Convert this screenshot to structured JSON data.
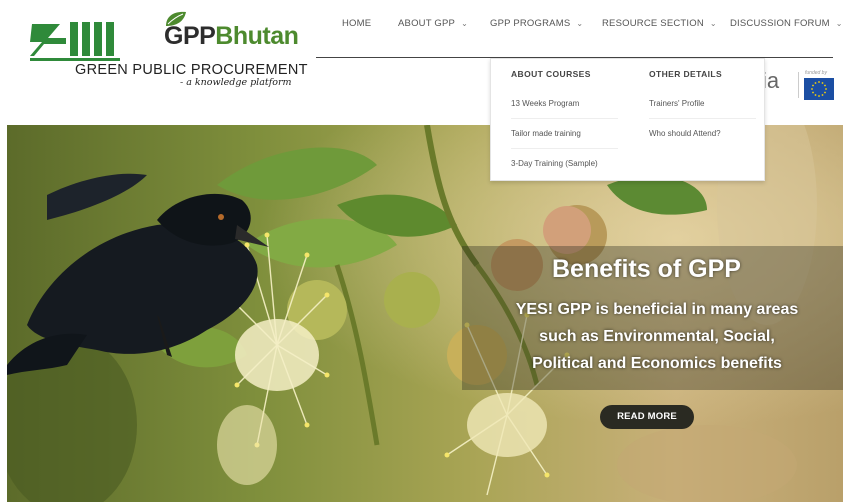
{
  "logo": {
    "bhutan_prefix": "GPP",
    "bhutan_suffix": "Bhutan",
    "name": "GREEN PUBLIC PROCUREMENT",
    "tagline": "- a knowledge platform"
  },
  "nav": {
    "items": [
      {
        "label": "HOME",
        "has_dropdown": false
      },
      {
        "label": "ABOUT GPP",
        "has_dropdown": true
      },
      {
        "label": "GPP PROGRAMS",
        "has_dropdown": true
      },
      {
        "label": "RESOURCE SECTION",
        "has_dropdown": true
      },
      {
        "label": "DISCUSSION FORUM",
        "has_dropdown": true
      }
    ]
  },
  "partner": {
    "text_fragment": "ia",
    "funded_by": "funded by"
  },
  "dropdown": {
    "about_courses": {
      "heading": "ABOUT COURSES",
      "links": [
        "13 Weeks Program",
        "Tailor made training",
        "3-Day Training (Sample)"
      ]
    },
    "other_details": {
      "heading": "OTHER DETAILS",
      "links": [
        "Trainers' Profile",
        "Who should Attend?"
      ]
    }
  },
  "hero": {
    "title": "Benefits of GPP",
    "text": "YES! GPP is beneficial in many areas such as Environmental, Social, Political and Economics benefits",
    "button": "READ MORE"
  },
  "colors": {
    "brand_green": "#4d8a2e",
    "eu_blue": "#1b4ea3",
    "button_dark": "#2a2a22"
  }
}
